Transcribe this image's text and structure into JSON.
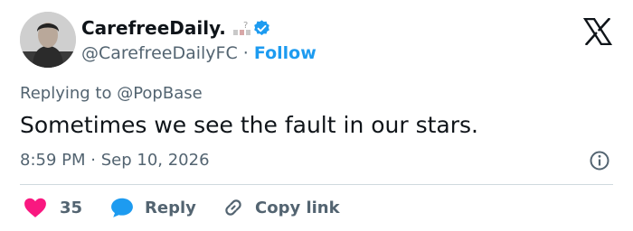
{
  "author": {
    "display_name": "CarefreeDaily.",
    "handle": "@CarefreeDailyFC",
    "separator": "·",
    "follow_label": "Follow"
  },
  "reply_context": "Replying to @PopBase",
  "tweet": {
    "text": "Sometimes we see the fault in our stars.",
    "time": "8:59 PM",
    "date": "Sep 10, 2026",
    "separator": "·"
  },
  "actions": {
    "likes_count": "35",
    "reply_label": "Reply",
    "copy_link_label": "Copy link"
  },
  "icons": {
    "like": "heart-icon",
    "reply": "speech-bubble-icon",
    "copy": "link-icon",
    "info": "info-icon",
    "platform": "x-logo-icon",
    "verified": "verified-badge-icon"
  },
  "colors": {
    "heart": "#f91880",
    "reply_bubble": "#1d9bf0",
    "follow": "#1d9bf0",
    "verified": "#1d9bf0",
    "muted_text": "#536471"
  }
}
